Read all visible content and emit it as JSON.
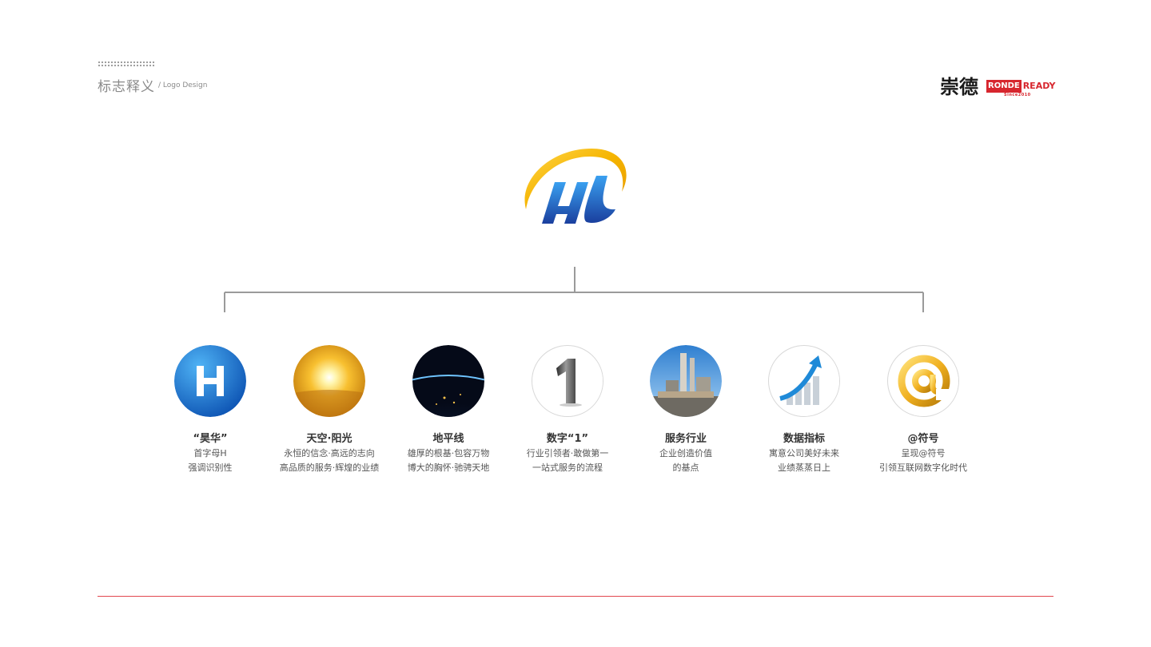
{
  "header": {
    "title": "标志释义",
    "subtitle": "/ Logo Design"
  },
  "brand": {
    "chinese_name": "崇德",
    "english_part1": "RONDE",
    "english_part2": "READY",
    "since": "Since2010",
    "color": "#d7262e"
  },
  "main_logo": {
    "icon": "hl-swoosh-logo-icon",
    "ring_color": "#f5b400",
    "letter_color": "#1f6fc9"
  },
  "items": [
    {
      "icon": "h-letter-icon",
      "title": "“昊华”",
      "lines": [
        "首字母H",
        "强调识别性"
      ]
    },
    {
      "icon": "sun-icon",
      "title": "天空·阳光",
      "lines": [
        "永恒的信念·高远的志向",
        "高品质的服务·辉煌的业绩"
      ]
    },
    {
      "icon": "earth-horizon-icon",
      "title": "地平线",
      "lines": [
        "雄厚的根基·包容万物",
        "博大的胸怀·驰骋天地"
      ]
    },
    {
      "icon": "number-one-icon",
      "title": "数字“1”",
      "lines": [
        "行业引领者·敢做第一",
        "一站式服务的流程"
      ]
    },
    {
      "icon": "factory-icon",
      "title": "服务行业",
      "lines": [
        "企业创造价值",
        "的基点"
      ]
    },
    {
      "icon": "growth-chart-icon",
      "title": "数据指标",
      "lines": [
        "寓意公司美好未来",
        "业绩蒸蒸日上"
      ]
    },
    {
      "icon": "at-sign-icon",
      "title": "@符号",
      "lines": [
        "呈现@符号",
        "引领互联网数字化时代"
      ]
    }
  ],
  "colors": {
    "accent_line": "#e2474f",
    "connector": "#9a9a9a"
  }
}
